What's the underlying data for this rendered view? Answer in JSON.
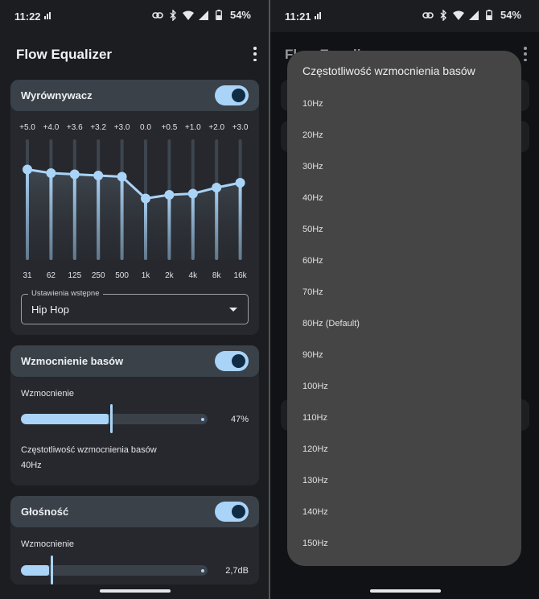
{
  "left": {
    "status": {
      "time": "11:22",
      "battery": "54%"
    },
    "app_title": "Flow Equalizer",
    "equalizer": {
      "label": "Wyrównywacz",
      "enabled": true,
      "bands": [
        {
          "gain": "+5.0",
          "freq": "31",
          "level": 0.75
        },
        {
          "gain": "+4.0",
          "freq": "62",
          "level": 0.72
        },
        {
          "gain": "+3.6",
          "freq": "125",
          "level": 0.71
        },
        {
          "gain": "+3.2",
          "freq": "250",
          "level": 0.7
        },
        {
          "gain": "+3.0",
          "freq": "500",
          "level": 0.69
        },
        {
          "gain": "0.0",
          "freq": "1k",
          "level": 0.51
        },
        {
          "gain": "+0.5",
          "freq": "2k",
          "level": 0.54
        },
        {
          "gain": "+1.0",
          "freq": "4k",
          "level": 0.55
        },
        {
          "gain": "+2.0",
          "freq": "8k",
          "level": 0.6
        },
        {
          "gain": "+3.0",
          "freq": "16k",
          "level": 0.64
        }
      ],
      "preset_label": "Ustawienia wstępne",
      "preset_value": "Hip Hop"
    },
    "bass_boost": {
      "label": "Wzmocnienie basów",
      "enabled": true,
      "strength_label": "Wzmocnienie",
      "strength_value": "47%",
      "strength_fraction": 0.47,
      "frequency_label": "Częstotliwość wzmocnienia basów",
      "frequency_value": "40Hz"
    },
    "volume": {
      "label": "Głośność",
      "enabled": true,
      "gain_label": "Wzmocnienie",
      "gain_value": "2,7dB",
      "gain_fraction": 0.15
    }
  },
  "right": {
    "status": {
      "time": "11:21",
      "battery": "54%"
    },
    "app_title_partial": "Flow Equalizer",
    "dialog": {
      "title": "Częstotliwość wzmocnienia basów",
      "options": [
        "10Hz",
        "20Hz",
        "30Hz",
        "40Hz",
        "50Hz",
        "60Hz",
        "70Hz",
        "80Hz (Default)",
        "90Hz",
        "100Hz",
        "110Hz",
        "120Hz",
        "130Hz",
        "140Hz",
        "150Hz"
      ]
    }
  }
}
